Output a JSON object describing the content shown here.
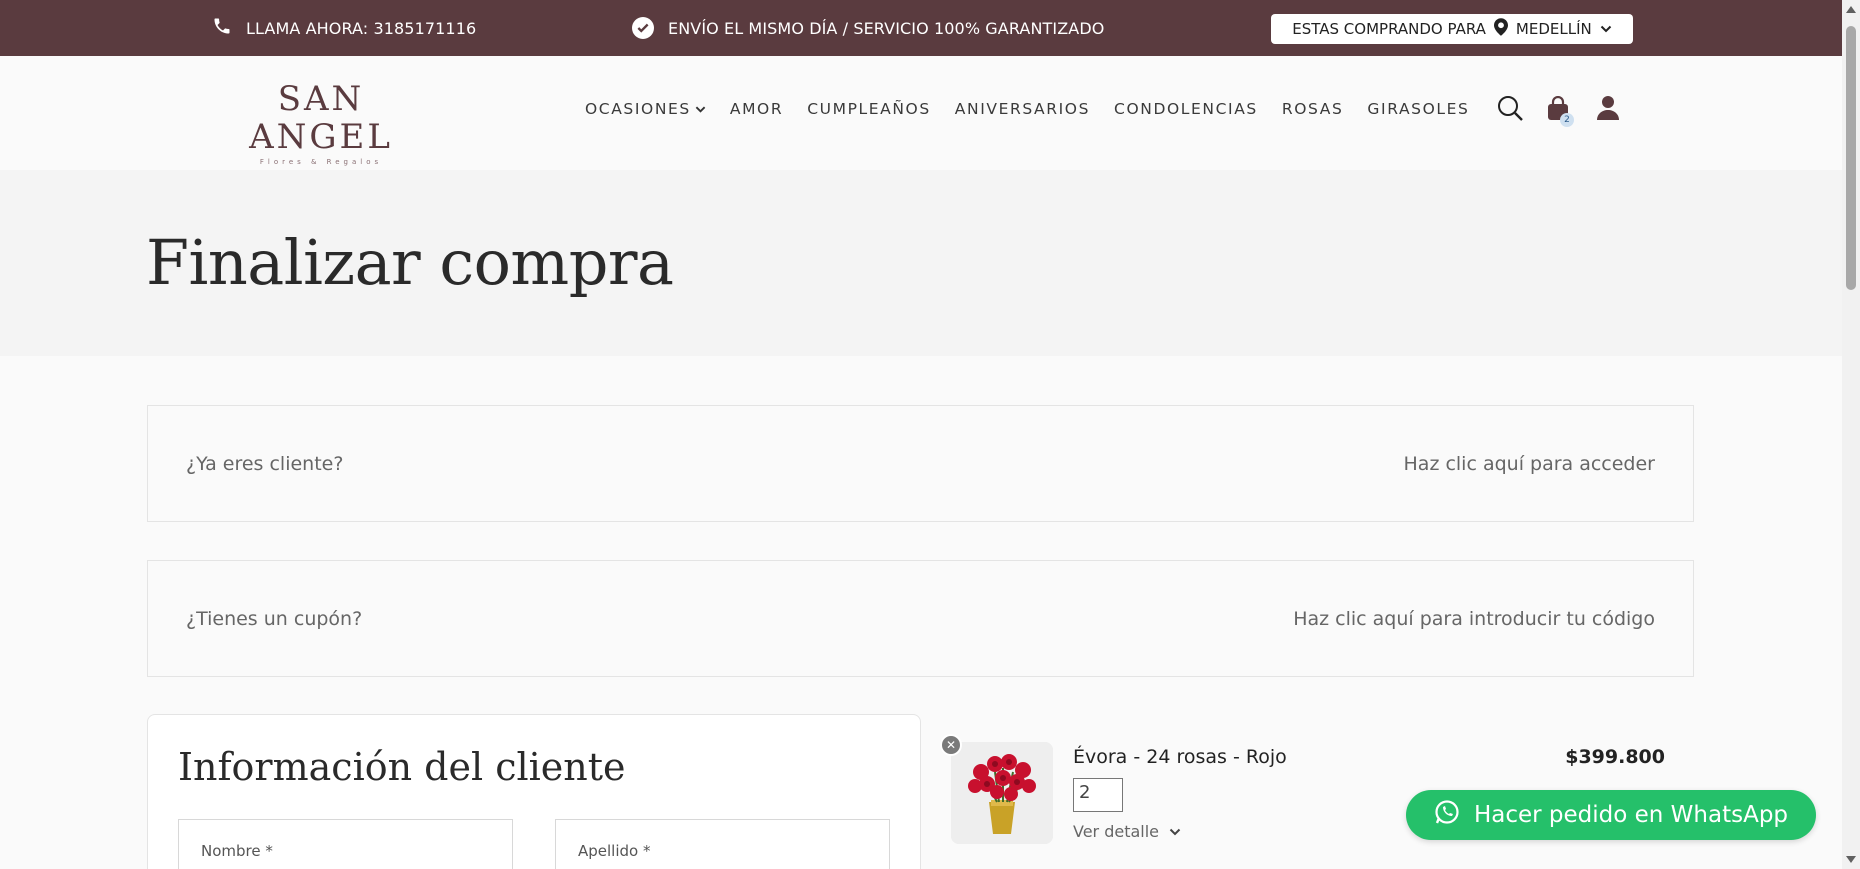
{
  "topbar": {
    "phone_text": "LLAMA AHORA: 3185171116",
    "shipping_text": "ENVÍO EL MISMO DÍA / SERVICIO 100% GARANTIZADO",
    "city_prefix": "ESTAS COMPRANDO PARA",
    "city_name": "MEDELLÍN"
  },
  "header": {
    "logo_name": "SAN ANGEL",
    "logo_tagline": "Flores & Regalos",
    "nav": [
      "OCASIONES",
      "AMOR",
      "CUMPLEAÑOS",
      "ANIVERSARIOS",
      "CONDOLENCIAS",
      "ROSAS",
      "GIRASOLES"
    ],
    "cart_count": "2"
  },
  "page": {
    "title": "Finalizar compra"
  },
  "notices": {
    "login_prompt": "¿Ya eres cliente?",
    "login_link": "Haz clic aquí para acceder",
    "coupon_prompt": "¿Tienes un cupón?",
    "coupon_link": "Haz clic aquí para introducir tu código"
  },
  "customer": {
    "heading": "Información del cliente",
    "first_name_label": "Nombre *",
    "last_name_label": "Apellido *"
  },
  "order": {
    "item_name": "Évora - 24 rosas - Rojo",
    "item_price": "$399.800",
    "item_qty": "2",
    "detail_label": "Ver detalle"
  },
  "whatsapp": {
    "label": "Hacer pedido en WhatsApp"
  },
  "colors": {
    "brand": "#5a3b3f",
    "whatsapp": "#25c06a"
  }
}
